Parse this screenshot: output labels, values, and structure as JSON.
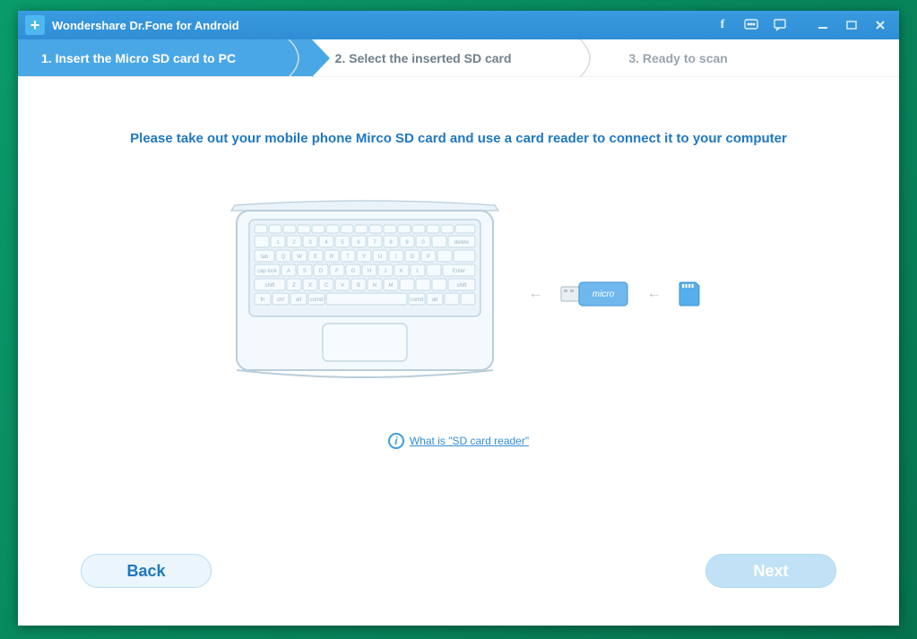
{
  "titlebar": {
    "title": "Wondershare Dr.Fone for Android"
  },
  "steps": {
    "s1": "1. Insert the Micro SD card to PC",
    "s2": "2. Select the inserted SD card",
    "s3": "3. Ready to scan"
  },
  "content": {
    "instruction": "Please take out your mobile phone Mirco SD card and use a card reader to connect it to your computer",
    "reader_label": "micro",
    "help_link": "What is \"SD card reader\""
  },
  "buttons": {
    "back": "Back",
    "next": "Next"
  }
}
